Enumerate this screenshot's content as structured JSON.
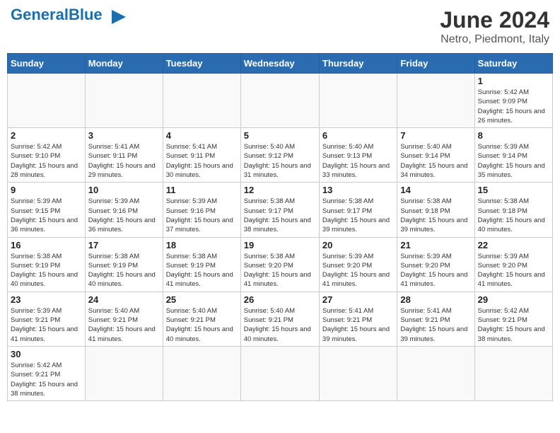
{
  "header": {
    "logo_general": "General",
    "logo_blue": "Blue",
    "month_year": "June 2024",
    "location": "Netro, Piedmont, Italy"
  },
  "weekdays": [
    "Sunday",
    "Monday",
    "Tuesday",
    "Wednesday",
    "Thursday",
    "Friday",
    "Saturday"
  ],
  "weeks": [
    [
      {
        "day": "",
        "info": ""
      },
      {
        "day": "",
        "info": ""
      },
      {
        "day": "",
        "info": ""
      },
      {
        "day": "",
        "info": ""
      },
      {
        "day": "",
        "info": ""
      },
      {
        "day": "",
        "info": ""
      },
      {
        "day": "1",
        "info": "Sunrise: 5:42 AM\nSunset: 9:09 PM\nDaylight: 15 hours and 26 minutes."
      }
    ],
    [
      {
        "day": "2",
        "info": "Sunrise: 5:42 AM\nSunset: 9:10 PM\nDaylight: 15 hours and 28 minutes."
      },
      {
        "day": "3",
        "info": "Sunrise: 5:41 AM\nSunset: 9:11 PM\nDaylight: 15 hours and 29 minutes."
      },
      {
        "day": "4",
        "info": "Sunrise: 5:41 AM\nSunset: 9:11 PM\nDaylight: 15 hours and 30 minutes."
      },
      {
        "day": "5",
        "info": "Sunrise: 5:40 AM\nSunset: 9:12 PM\nDaylight: 15 hours and 31 minutes."
      },
      {
        "day": "6",
        "info": "Sunrise: 5:40 AM\nSunset: 9:13 PM\nDaylight: 15 hours and 33 minutes."
      },
      {
        "day": "7",
        "info": "Sunrise: 5:40 AM\nSunset: 9:14 PM\nDaylight: 15 hours and 34 minutes."
      },
      {
        "day": "8",
        "info": "Sunrise: 5:39 AM\nSunset: 9:14 PM\nDaylight: 15 hours and 35 minutes."
      }
    ],
    [
      {
        "day": "9",
        "info": "Sunrise: 5:39 AM\nSunset: 9:15 PM\nDaylight: 15 hours and 36 minutes."
      },
      {
        "day": "10",
        "info": "Sunrise: 5:39 AM\nSunset: 9:16 PM\nDaylight: 15 hours and 36 minutes."
      },
      {
        "day": "11",
        "info": "Sunrise: 5:39 AM\nSunset: 9:16 PM\nDaylight: 15 hours and 37 minutes."
      },
      {
        "day": "12",
        "info": "Sunrise: 5:38 AM\nSunset: 9:17 PM\nDaylight: 15 hours and 38 minutes."
      },
      {
        "day": "13",
        "info": "Sunrise: 5:38 AM\nSunset: 9:17 PM\nDaylight: 15 hours and 39 minutes."
      },
      {
        "day": "14",
        "info": "Sunrise: 5:38 AM\nSunset: 9:18 PM\nDaylight: 15 hours and 39 minutes."
      },
      {
        "day": "15",
        "info": "Sunrise: 5:38 AM\nSunset: 9:18 PM\nDaylight: 15 hours and 40 minutes."
      }
    ],
    [
      {
        "day": "16",
        "info": "Sunrise: 5:38 AM\nSunset: 9:19 PM\nDaylight: 15 hours and 40 minutes."
      },
      {
        "day": "17",
        "info": "Sunrise: 5:38 AM\nSunset: 9:19 PM\nDaylight: 15 hours and 40 minutes."
      },
      {
        "day": "18",
        "info": "Sunrise: 5:38 AM\nSunset: 9:19 PM\nDaylight: 15 hours and 41 minutes."
      },
      {
        "day": "19",
        "info": "Sunrise: 5:38 AM\nSunset: 9:20 PM\nDaylight: 15 hours and 41 minutes."
      },
      {
        "day": "20",
        "info": "Sunrise: 5:39 AM\nSunset: 9:20 PM\nDaylight: 15 hours and 41 minutes."
      },
      {
        "day": "21",
        "info": "Sunrise: 5:39 AM\nSunset: 9:20 PM\nDaylight: 15 hours and 41 minutes."
      },
      {
        "day": "22",
        "info": "Sunrise: 5:39 AM\nSunset: 9:20 PM\nDaylight: 15 hours and 41 minutes."
      }
    ],
    [
      {
        "day": "23",
        "info": "Sunrise: 5:39 AM\nSunset: 9:21 PM\nDaylight: 15 hours and 41 minutes."
      },
      {
        "day": "24",
        "info": "Sunrise: 5:40 AM\nSunset: 9:21 PM\nDaylight: 15 hours and 41 minutes."
      },
      {
        "day": "25",
        "info": "Sunrise: 5:40 AM\nSunset: 9:21 PM\nDaylight: 15 hours and 40 minutes."
      },
      {
        "day": "26",
        "info": "Sunrise: 5:40 AM\nSunset: 9:21 PM\nDaylight: 15 hours and 40 minutes."
      },
      {
        "day": "27",
        "info": "Sunrise: 5:41 AM\nSunset: 9:21 PM\nDaylight: 15 hours and 39 minutes."
      },
      {
        "day": "28",
        "info": "Sunrise: 5:41 AM\nSunset: 9:21 PM\nDaylight: 15 hours and 39 minutes."
      },
      {
        "day": "29",
        "info": "Sunrise: 5:42 AM\nSunset: 9:21 PM\nDaylight: 15 hours and 38 minutes."
      }
    ],
    [
      {
        "day": "30",
        "info": "Sunrise: 5:42 AM\nSunset: 9:21 PM\nDaylight: 15 hours and 38 minutes."
      },
      {
        "day": "",
        "info": ""
      },
      {
        "day": "",
        "info": ""
      },
      {
        "day": "",
        "info": ""
      },
      {
        "day": "",
        "info": ""
      },
      {
        "day": "",
        "info": ""
      },
      {
        "day": "",
        "info": ""
      }
    ]
  ]
}
